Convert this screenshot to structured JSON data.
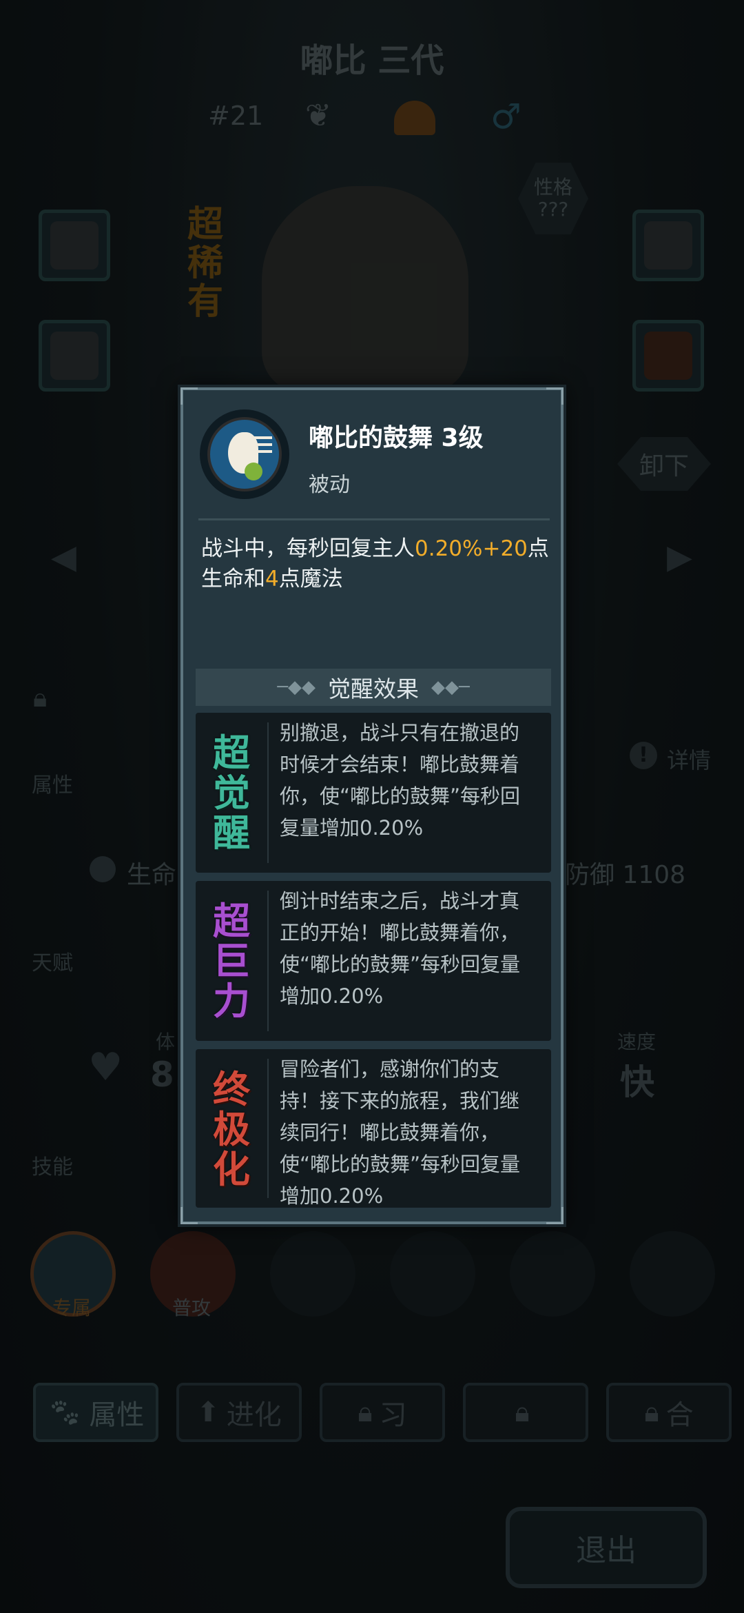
{
  "header": {
    "title": "嘟比 三代",
    "number": "#21"
  },
  "rarity": "超稀有",
  "personality": {
    "label": "性格",
    "value": "???"
  },
  "unequip_label": "卸下",
  "background_labels": {
    "attributes": "属性",
    "details": "详情",
    "hp_label": "生命",
    "defense": "防御 1108",
    "talent": "天赋",
    "stamina_label": "体",
    "stamina_value": "8.",
    "speed_label": "速度",
    "speed_value": "快",
    "skills": "技能",
    "exclusive": "专属",
    "normal_attack": "普攻"
  },
  "tabs": [
    "属性",
    "进化",
    "习",
    "",
    "合"
  ],
  "exit_label": "退出",
  "modal": {
    "skill_name": "嘟比的鼓舞 3级",
    "skill_type": "被动",
    "desc_parts": [
      {
        "text": "战斗中，每秒回复主人",
        "highlight": false
      },
      {
        "text": "0.20%+20",
        "highlight": true
      },
      {
        "text": "点生命和",
        "highlight": false
      },
      {
        "text": "4",
        "highlight": true
      },
      {
        "text": "点魔法",
        "highlight": false
      }
    ],
    "awaken_header": "觉醒效果",
    "awakenings": [
      {
        "badge": "超觉醒",
        "color": "#3fb89a",
        "text": "别撤退，战斗只有在撤退的时候才会结束！嘟比鼓舞着你，使“嘟比的鼓舞”每秒回复量增加0.20%"
      },
      {
        "badge": "超巨力",
        "color": "#a84fd0",
        "text": "倒计时结束之后，战斗才真正的开始！嘟比鼓舞着你，使“嘟比的鼓舞”每秒回复量增加0.20%"
      },
      {
        "badge": "终极化",
        "color": "#d24a3a",
        "text": "冒险者们，感谢你们的支持！接下来的旅程，我们继续同行！嘟比鼓舞着你，使“嘟比的鼓舞”每秒回复量增加0.20%"
      }
    ]
  },
  "colors": {
    "highlight": "#f2ad2a",
    "modal_bg": "#253740",
    "title": "#ffffff"
  }
}
